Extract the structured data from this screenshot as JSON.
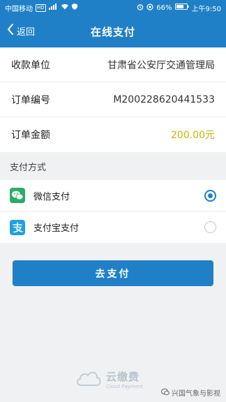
{
  "status_bar": {
    "carrier": "中国移动",
    "network_badge": "HD",
    "battery_percent": "66%",
    "time": "上午9:50"
  },
  "nav": {
    "back_label": "返回",
    "title": "在线支付"
  },
  "order": {
    "rows": [
      {
        "label": "收款单位",
        "value": "甘肃省公安厅交通管理局"
      },
      {
        "label": "订单编号",
        "value": "M200228620441533"
      },
      {
        "label": "订单金额",
        "value": "200.00元"
      }
    ]
  },
  "payment": {
    "section_title": "支付方式",
    "methods": [
      {
        "label": "微信支付",
        "icon": "wechat-pay-icon",
        "selected": true
      },
      {
        "label": "支付宝支付",
        "icon": "alipay-icon",
        "selected": false
      }
    ]
  },
  "pay_button_label": "去支付",
  "footer": {
    "brand_cn": "云缴费",
    "brand_en": "Cloud Payment"
  },
  "watermark": "兴国气象与影视",
  "colors": {
    "primary": "#1f80c8",
    "amount": "#c8b400",
    "wechat": "#2aae67",
    "alipay": "#1fa0e6"
  }
}
